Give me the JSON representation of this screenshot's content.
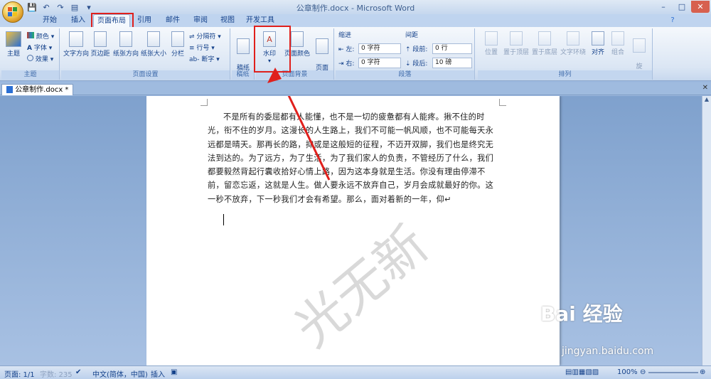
{
  "window": {
    "title": "公章制作.docx - Microsoft Word",
    "minimize": "–",
    "maximize": "□",
    "close": "✕"
  },
  "qat": {
    "save": "💾",
    "undo": "↶",
    "redo": "↷",
    "preview": "▤",
    "more": "▾"
  },
  "tabs": [
    {
      "label": "开始"
    },
    {
      "label": "插入"
    },
    {
      "label": "页面布局"
    },
    {
      "label": "引用"
    },
    {
      "label": "邮件"
    },
    {
      "label": "审阅"
    },
    {
      "label": "视图"
    },
    {
      "label": "开发工具"
    }
  ],
  "help_icon": "?",
  "ribbon": {
    "theme_group": {
      "label": "主题",
      "theme_button": "主题",
      "colors": "颜色",
      "fonts": "字体",
      "effects": "效果"
    },
    "page_setup_group": {
      "label": "页面设置",
      "text_direction": "文字方向",
      "margins": "页边距",
      "orientation": "纸张方向",
      "size": "纸张大小",
      "columns": "分栏",
      "breaks": "分隔符",
      "line_numbers": "行号",
      "hyphenation": "断字"
    },
    "draft_group": {
      "label": "稿纸",
      "draft_settings": "稿纸\n设置"
    },
    "page_background_group": {
      "label": "页面背景",
      "watermark": "水印",
      "page_color": "页面颜色",
      "page_borders": "页面\n边框"
    },
    "paragraph_group": {
      "label": "段落",
      "indent": "缩进",
      "indent_left_label": "左:",
      "indent_left_value": "0 字符",
      "indent_right_label": "右:",
      "indent_right_value": "0 字符",
      "spacing": "间距",
      "spacing_before_label": "段前:",
      "spacing_before_value": "0 行",
      "spacing_after_label": "段后:",
      "spacing_after_value": "10 磅"
    },
    "arrange_group": {
      "label": "排列",
      "position": "位置",
      "bring_front": "置于顶层",
      "send_back": "置于底层",
      "text_wrap": "文字环绕",
      "align": "对齐",
      "group": "组合",
      "rotate": "旋\n转"
    }
  },
  "doc_tab": {
    "name": "公章制作.docx *"
  },
  "document": {
    "paragraph": "不是所有的委屈都有人能懂，也不是一切的疲惫都有人能疼。揪不住的时光，衔不住的岁月。这漫长的人生路上，我们不可能一帆风顺，也不可能每天永远都是晴天。那再长的路，抑或是这般短的征程，不迈开双脚，我们也是终究无法到达的。为了远方，为了生活，为了我们家人的负责，不管经历了什么，我们都要毅然背起行囊收拾好心情上路，因为这本身就是生活。你没有理由停滞不前，留恋忘返，这就是人生。做人要永远不放弃自己，岁月会成就最好的你。这一秒不放弃，下一秒我们才会有希望。那么，面对着新的一年，仰↵",
    "watermark": "光无新"
  },
  "status": {
    "page": "页面: 1/1",
    "words": "字数: 235",
    "language": "中文(简体，中国)",
    "mode": "插入",
    "zoom": "100%"
  },
  "overlay": {
    "baidu_logo": "Bai 经验",
    "baidu_url": "jingyan.baidu.com"
  },
  "colors": {
    "accent_red": "#e0201c",
    "ribbon_text": "#15428b"
  }
}
